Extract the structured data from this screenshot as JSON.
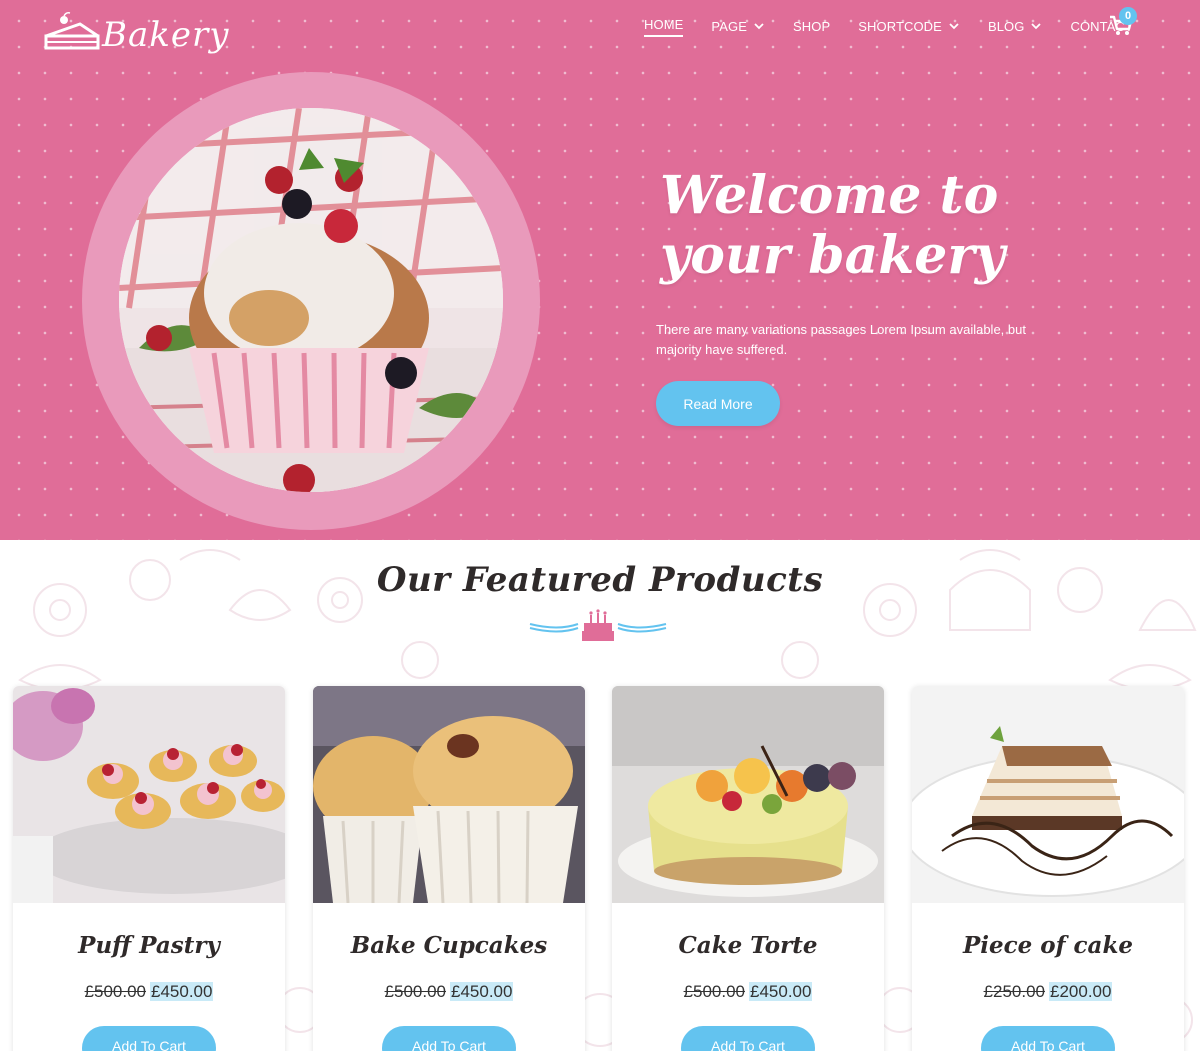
{
  "brand": {
    "name": "Bakery"
  },
  "nav": {
    "items": [
      {
        "label": "HOME",
        "dropdown": false,
        "active": true
      },
      {
        "label": "PAGE",
        "dropdown": true,
        "active": false
      },
      {
        "label": "SHOP",
        "dropdown": false,
        "active": false
      },
      {
        "label": "SHORTCODE",
        "dropdown": true,
        "active": false
      },
      {
        "label": "BLOG",
        "dropdown": true,
        "active": false
      },
      {
        "label": "CONTACT",
        "dropdown": false,
        "active": false
      }
    ],
    "cart_count": "0",
    "cart_icon": "shopping-cart-icon"
  },
  "hero": {
    "title_line1": "Welcome to",
    "title_line2": "your bakery",
    "subtitle": "There are many variations passages Lorem Ipsum available, but majority have suffered.",
    "button": "Read More",
    "image": "muffin-with-berries-photo"
  },
  "featured": {
    "title": "Our Featured Products",
    "divider_icon": "birthday-cake-icon",
    "products": [
      {
        "name": "Puff Pastry",
        "old_price": "£500.00",
        "price": "£450.00",
        "button": "Add To Cart",
        "image": "puff-pastry-photo"
      },
      {
        "name": "Bake Cupcakes",
        "old_price": "£500.00",
        "price": "£450.00",
        "button": "Add To Cart",
        "image": "cupcakes-photo"
      },
      {
        "name": "Cake Torte",
        "old_price": "£500.00",
        "price": "£450.00",
        "button": "Add To Cart",
        "image": "cake-torte-photo"
      },
      {
        "name": "Piece of cake",
        "old_price": "£250.00",
        "price": "£200.00",
        "button": "Add To Cart",
        "image": "piece-of-cake-photo"
      }
    ]
  },
  "colors": {
    "hero_bg": "#e06d98",
    "ring": "#e99abb",
    "accent": "#63c3ef",
    "price_highlight": "#c9eaf7",
    "heading": "#2f2a2a"
  }
}
